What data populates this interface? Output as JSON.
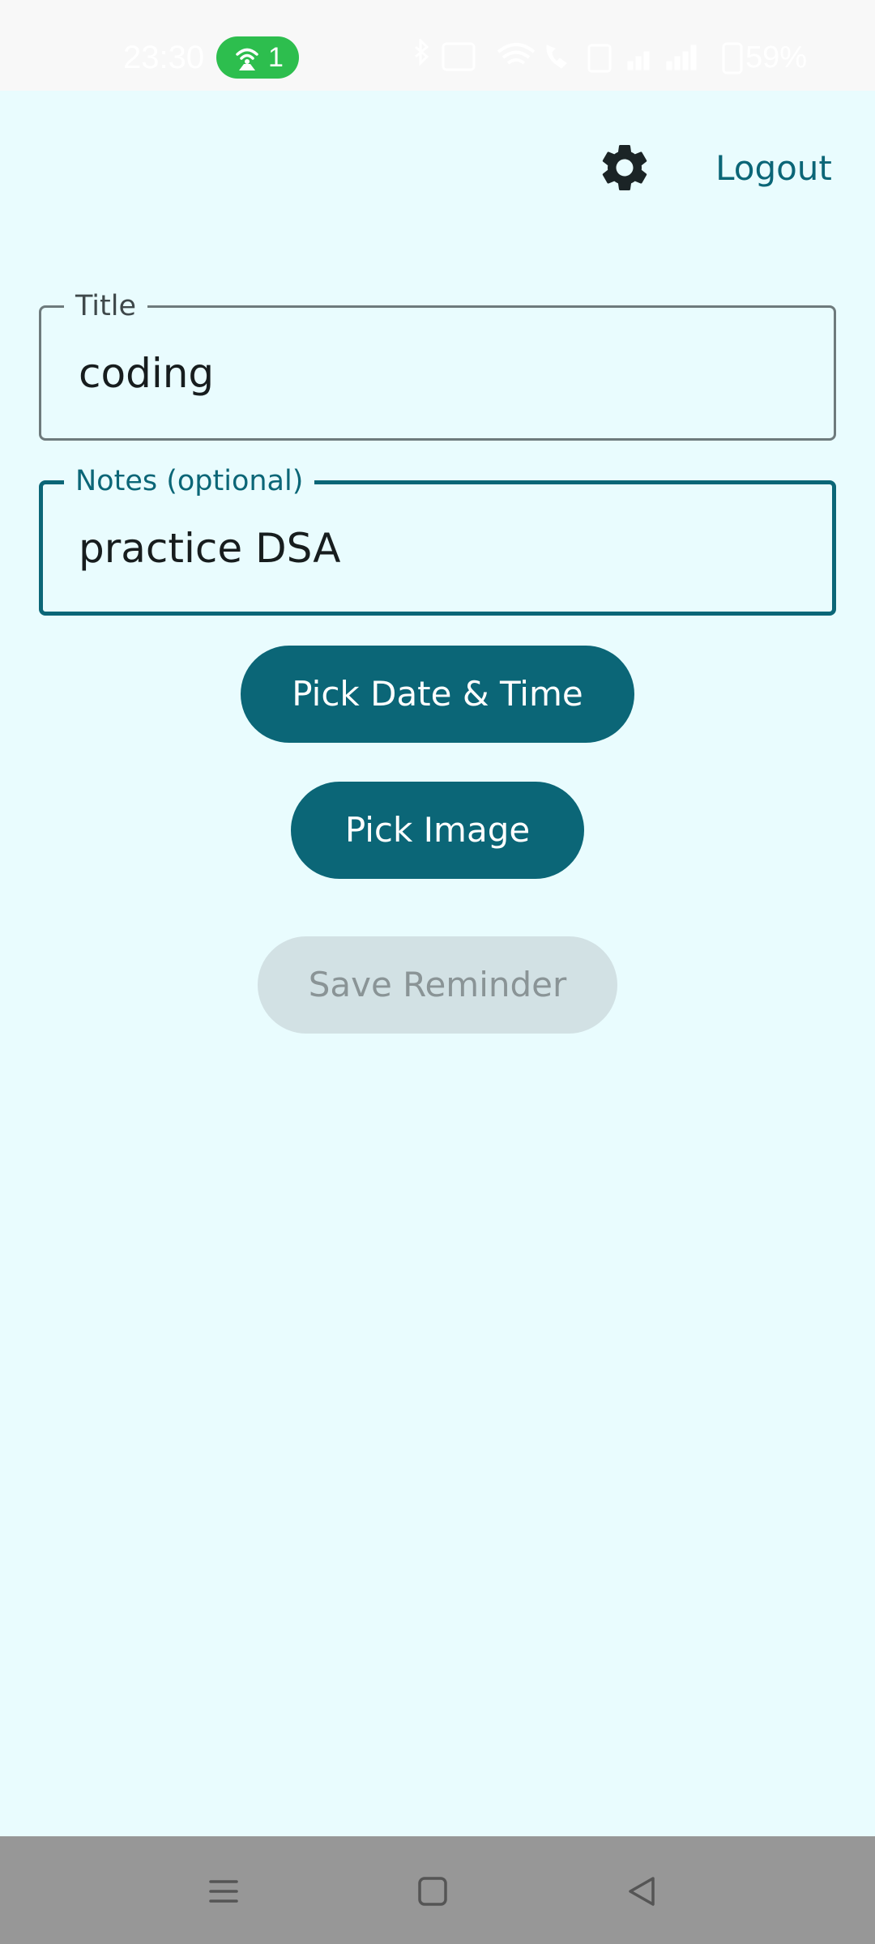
{
  "status_bar": {
    "time": "23:30",
    "notification_count": "1",
    "battery": "59%",
    "pill_color": "#2dbe4e"
  },
  "header": {
    "settings_icon": "gear-icon",
    "logout_label": "Logout"
  },
  "form": {
    "title_label": "Title",
    "title_value": "coding",
    "notes_label": "Notes (optional)",
    "notes_value": "practice DSA"
  },
  "actions": {
    "pick_date_label": "Pick Date & Time",
    "pick_image_label": "Pick Image",
    "save_label": "Save Reminder",
    "save_enabled": false
  },
  "nav_bar": {
    "menu_icon": "menu-icon",
    "home_icon": "home-icon",
    "back_icon": "back-icon"
  },
  "colors": {
    "primary": "#0b6677",
    "background": "#e9fcfe",
    "disabled_bg": "#d2e1e4",
    "disabled_text": "#8a9496"
  }
}
